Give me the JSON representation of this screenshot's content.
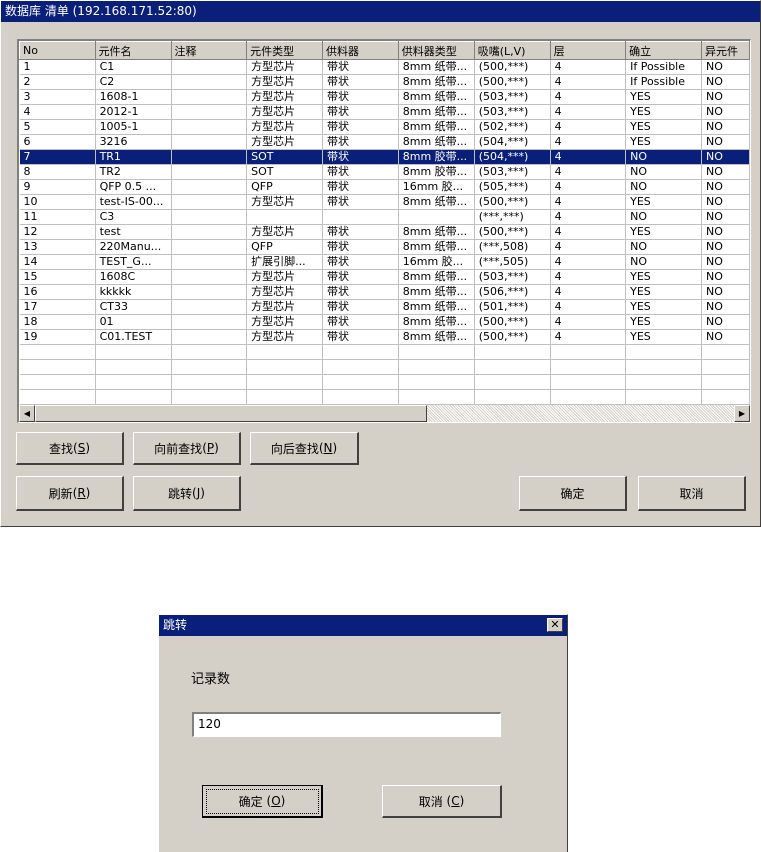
{
  "main_window": {
    "title": "数据库 清单  (192.168.171.52:80)",
    "columns": [
      "No",
      "元件名",
      "注释",
      "元件类型",
      "供料器",
      "供料器类型",
      "吸嘴(L,V)",
      "层",
      "确立",
      "异元件"
    ],
    "rows": [
      [
        "1",
        "C1",
        "",
        "方型芯片",
        "带状",
        "8mm 纸带...",
        "(500,***)",
        "4",
        "If Possible",
        "NO"
      ],
      [
        "2",
        "C2",
        "",
        "方型芯片",
        "带状",
        "8mm 纸带...",
        "(500,***)",
        "4",
        "If Possible",
        "NO"
      ],
      [
        "3",
        "1608-1",
        "",
        "方型芯片",
        "带状",
        "8mm 纸带...",
        "(503,***)",
        "4",
        "YES",
        "NO"
      ],
      [
        "4",
        "2012-1",
        "",
        "方型芯片",
        "带状",
        "8mm 纸带...",
        "(503,***)",
        "4",
        "YES",
        "NO"
      ],
      [
        "5",
        "1005-1",
        "",
        "方型芯片",
        "带状",
        "8mm 纸带...",
        "(502,***)",
        "4",
        "YES",
        "NO"
      ],
      [
        "6",
        "3216",
        "",
        "方型芯片",
        "带状",
        "8mm 纸带...",
        "(504,***)",
        "4",
        "YES",
        "NO"
      ],
      [
        "7",
        "TR1",
        "",
        "SOT",
        "带状",
        "8mm 胶带...",
        "(504,***)",
        "4",
        "NO",
        "NO"
      ],
      [
        "8",
        "TR2",
        "",
        "SOT",
        "带状",
        "8mm 胶带...",
        "(503,***)",
        "4",
        "NO",
        "NO"
      ],
      [
        "9",
        "QFP 0.5 ...",
        "",
        "QFP",
        "带状",
        "16mm 胶...",
        "(505,***)",
        "4",
        "NO",
        "NO"
      ],
      [
        "10",
        "test-IS-00...",
        "",
        "方型芯片",
        "带状",
        "8mm 纸带...",
        "(500,***)",
        "4",
        "YES",
        "NO"
      ],
      [
        "11",
        "C3",
        "",
        "",
        "",
        "",
        "(***,***)",
        "4",
        "NO",
        "NO"
      ],
      [
        "12",
        "test",
        "",
        "方型芯片",
        "带状",
        "8mm 纸带...",
        "(500,***)",
        "4",
        "YES",
        "NO"
      ],
      [
        "13",
        "220Manu...",
        "",
        "QFP",
        "带状",
        "8mm 纸带...",
        "(***,508)",
        "4",
        "NO",
        "NO"
      ],
      [
        "14",
        "TEST_G...",
        "",
        "扩展引脚...",
        "带状",
        "16mm 胶...",
        "(***,505)",
        "4",
        "NO",
        "NO"
      ],
      [
        "15",
        "1608C",
        "",
        "方型芯片",
        "带状",
        "8mm 纸带...",
        "(503,***)",
        "4",
        "YES",
        "NO"
      ],
      [
        "16",
        "kkkkk",
        "",
        "方型芯片",
        "带状",
        "8mm 纸带...",
        "(506,***)",
        "4",
        "YES",
        "NO"
      ],
      [
        "17",
        "CT33",
        "",
        "方型芯片",
        "带状",
        "8mm 纸带...",
        "(501,***)",
        "4",
        "YES",
        "NO"
      ],
      [
        "18",
        "01",
        "",
        "方型芯片",
        "带状",
        "8mm 纸带...",
        "(500,***)",
        "4",
        "YES",
        "NO"
      ],
      [
        "19",
        "C01.TEST",
        "",
        "方型芯片",
        "带状",
        "8mm 纸带...",
        "(500,***)",
        "4",
        "YES",
        "NO"
      ]
    ],
    "selected_row": "7",
    "buttons": {
      "find": "查找",
      "find_key": "S",
      "find_prev": "向前查找",
      "find_prev_key": "P",
      "find_next": "向后查找",
      "find_next_key": "N",
      "refresh": "刷新",
      "refresh_key": "R",
      "jump": "跳转",
      "jump_key": "J",
      "ok": "确定",
      "cancel": "取消"
    }
  },
  "jump_dialog": {
    "title": "跳转",
    "label": "记录数",
    "input_value": "120",
    "ok_label": "确定",
    "ok_key": "O",
    "cancel_label": "取消",
    "cancel_key": "C"
  },
  "colors": {
    "title_bar": "#0a1f7a",
    "selection": "#0a1f7a",
    "face": "#d4d0c8"
  }
}
